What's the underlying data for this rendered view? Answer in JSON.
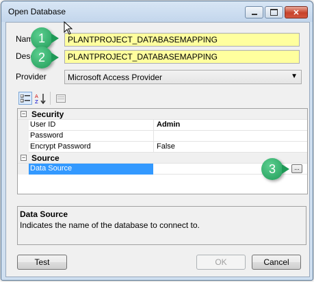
{
  "window": {
    "title": "Open Database",
    "minimize_icon": "minimize-icon",
    "maximize_icon": "maximize-icon",
    "close_icon": "close-icon"
  },
  "form": {
    "name_label": "Nam",
    "name_value": "PLANTPROJECT_DATABASEMAPPING",
    "description_label": "Desc",
    "description_value": "PLANTPROJECT_DATABASEMAPPING",
    "provider_label": "Provider",
    "provider_value": "Microsoft Access Provider",
    "highlight_color": "#ffff9e"
  },
  "toolbar": {
    "categorized_icon": "categorized-view-icon",
    "alphabetical_icon": "alphabetical-sort-icon",
    "property_pages_icon": "property-pages-icon"
  },
  "grid": {
    "categories": [
      {
        "name": "Security",
        "toggle": "⊟",
        "properties": [
          {
            "name": "User ID",
            "value": "Admin"
          },
          {
            "name": "Password",
            "value": ""
          },
          {
            "name": "Encrypt Password",
            "value": "False"
          }
        ]
      },
      {
        "name": "Source",
        "toggle": "⊟",
        "properties": [
          {
            "name": "Data Source",
            "value": "",
            "selected": true
          }
        ]
      }
    ],
    "ellipsis_label": "...",
    "selection_color": "#3399ff"
  },
  "help": {
    "title": "Data Source",
    "description": "Indicates the name of the database to connect to."
  },
  "buttons": {
    "test": "Test",
    "ok": "OK",
    "cancel": "Cancel"
  },
  "callouts": [
    "1",
    "2",
    "3"
  ],
  "callout_color": "#2aa862"
}
